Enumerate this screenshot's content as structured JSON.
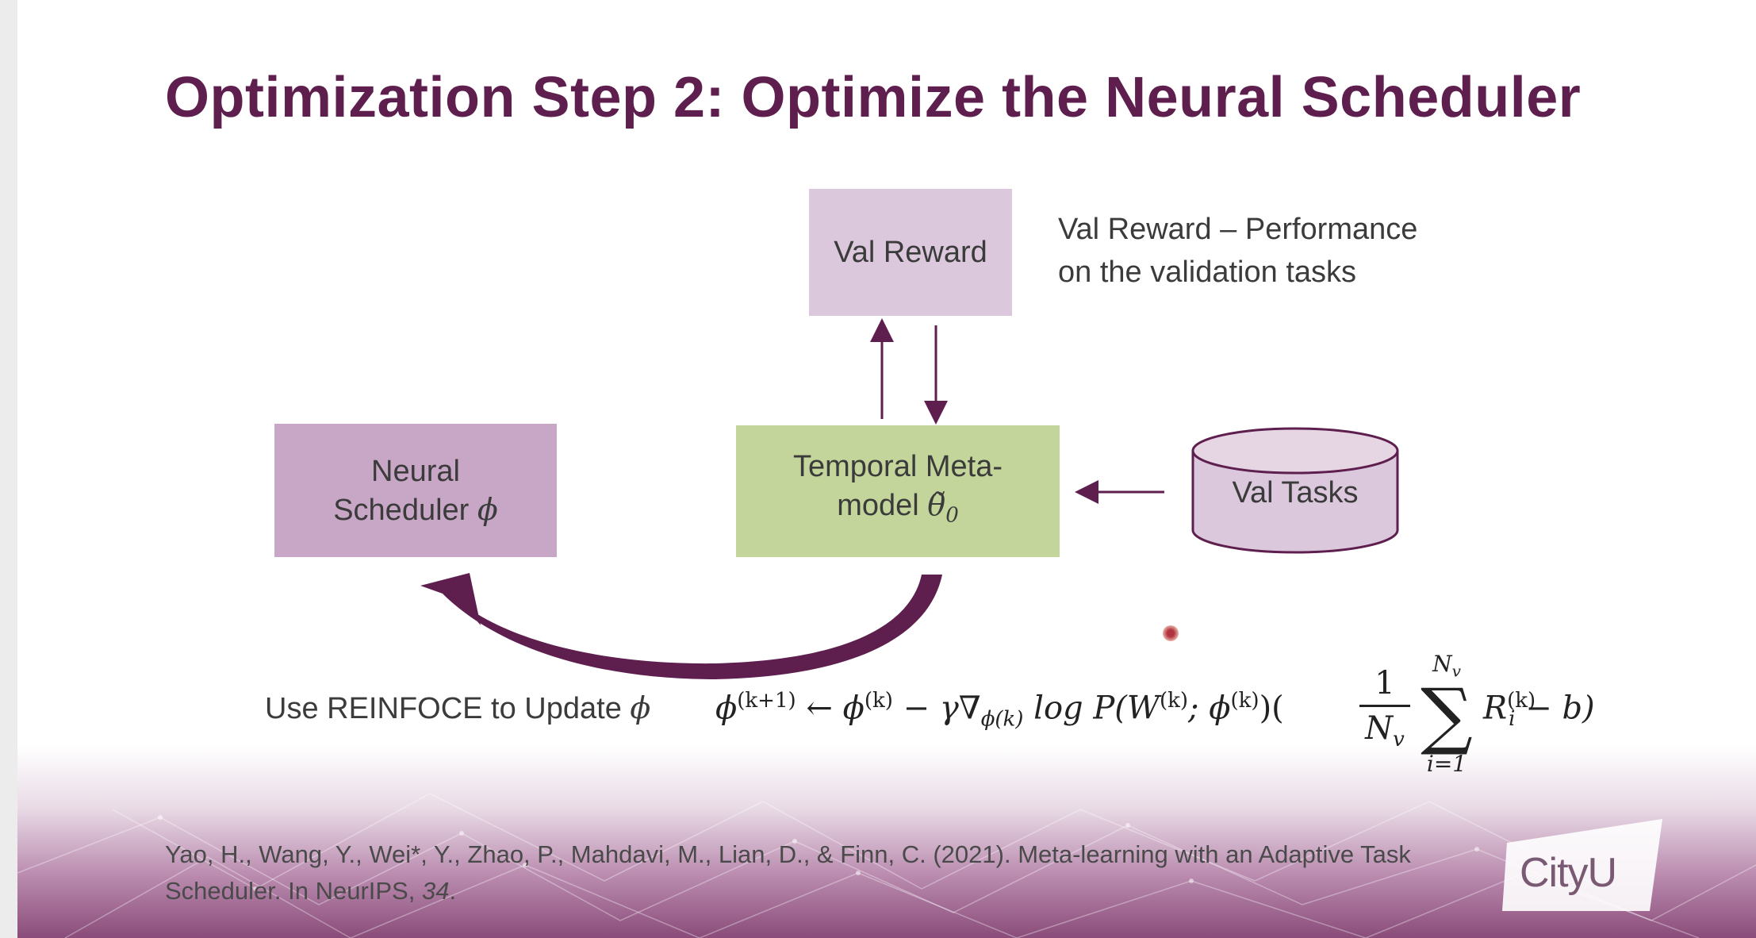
{
  "slide": {
    "title": "Optimization Step 2: Optimize the Neural Scheduler",
    "val_reward_box": "Val Reward",
    "val_reward_note_line1": "Val Reward – Performance",
    "val_reward_note_line2": "on the validation tasks",
    "neural_line1": "Neural",
    "neural_line2": "Scheduler ",
    "phi": "ϕ",
    "temporal_line1": "Temporal Meta-",
    "temporal_line2": "model ",
    "theta": "θ̃",
    "theta_sub": "0",
    "val_tasks": "Val Tasks",
    "reinforce_label": "Use REINFOCE to Update ",
    "formula": {
      "lhs": "ϕ",
      "lhs_sup": "(k+1)",
      "arrow_part": " ← ϕ",
      "phi_sup": "(k)",
      "minus_gamma": " − γ∇",
      "grad_sub": "ϕ(k)",
      "log_part": " log P(W",
      "w_sup": "(k)",
      "semi_phi": "; ϕ",
      "semi_phi_sup": "(k)",
      "close_paren": ")(",
      "frac_num": "1",
      "frac_den": "N",
      "frac_den_sub": "v",
      "sum_top": "N",
      "sum_top_sub": "v",
      "sum_symbol": "∑",
      "sum_bottom": "i=1",
      "r": "R",
      "r_sub": "i",
      "r_sup": "(k)",
      "minus_b": " − b)"
    },
    "citation_line1": "Yao, H., Wang, Y., Wei*, Y., Zhao, P., Mahdavi, M., Lian, D., & Finn, C. (2021). Meta-learning with an Adaptive Task",
    "citation_line2": "Scheduler. In NeurIPS, ",
    "citation_venue": "34",
    "citation_end": ".",
    "logo_text": "CityU"
  },
  "colors": {
    "title": "#5e1f4f",
    "val_reward_box": "#dcc8dc",
    "neural_box": "#c8a6c6",
    "temporal_box": "#c3d59a",
    "cylinder": "#dcc8dc",
    "arrows": "#5e1f4f"
  }
}
